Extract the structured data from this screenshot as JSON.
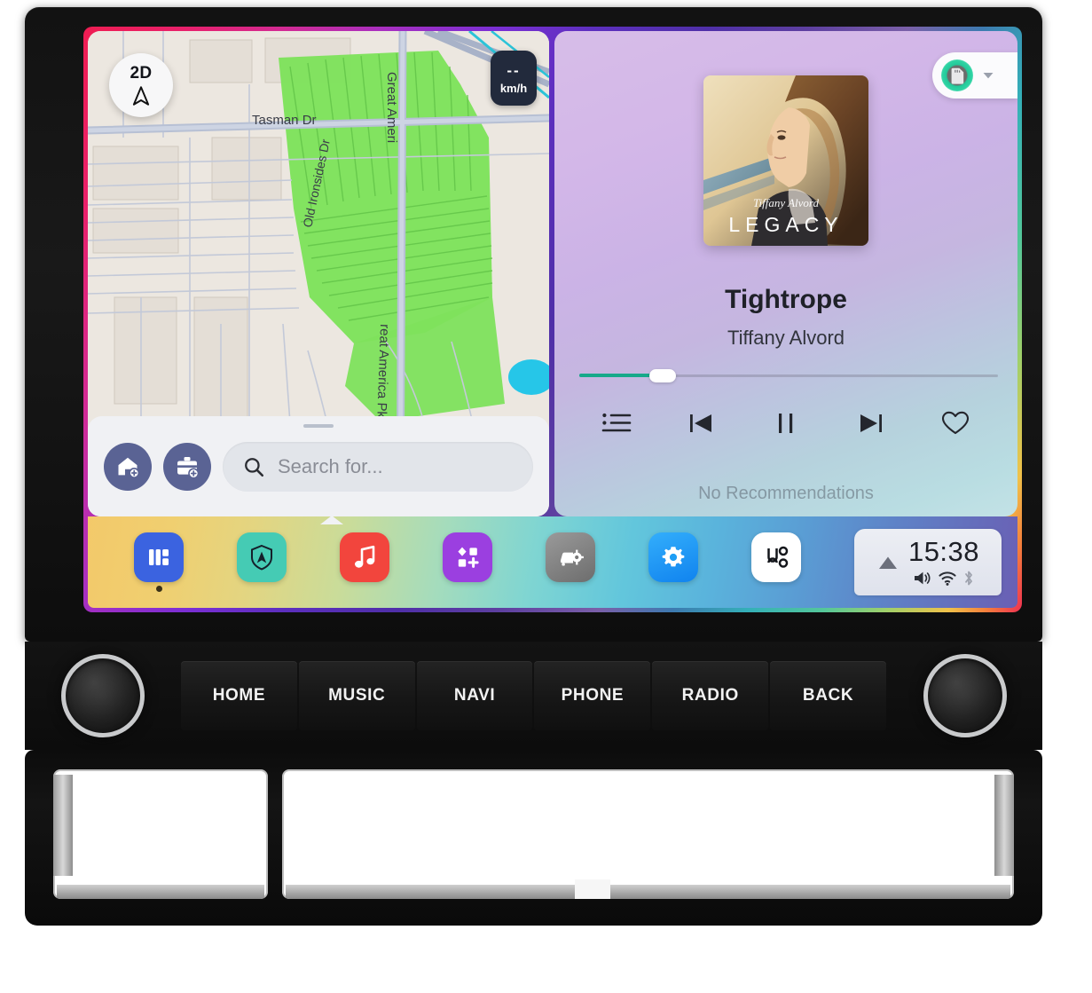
{
  "device": {
    "type": "car-head-unit",
    "screen_label": "touchscreen-display"
  },
  "map": {
    "view_mode_label": "2D",
    "compass_icon": "navigation-arrow-icon",
    "speed": {
      "value": "--",
      "unit": "km/h"
    },
    "streets": [
      "Tasman Dr",
      "Great America Pkwy",
      "Old Ironsides Dr",
      "Great America Pkwy"
    ],
    "shortcuts": [
      {
        "name": "home-shortcut",
        "icon": "home-add-icon"
      },
      {
        "name": "work-shortcut",
        "icon": "briefcase-add-icon"
      }
    ],
    "search": {
      "placeholder": "Search for...",
      "icon": "search-icon",
      "value": ""
    },
    "colors": {
      "land": "#ece7e0",
      "park_green": "#7ee25c",
      "water": "#26c6e8",
      "road": "#b7c0d4"
    }
  },
  "music": {
    "source_badge": {
      "icon": "sd-card-icon",
      "chevron": "chevron-down-icon",
      "ring_color": "#2fd4a4"
    },
    "album_art_label": "LEGACY",
    "album_art_signature": "Tiffany Alvord",
    "title": "Tightrope",
    "artist": "Tiffany Alvord",
    "progress_percent": 18,
    "progress_color": "#16a98a",
    "controls": [
      {
        "name": "playlist-button",
        "icon": "playlist-icon"
      },
      {
        "name": "previous-button",
        "icon": "skip-previous-icon"
      },
      {
        "name": "pause-button",
        "icon": "pause-icon"
      },
      {
        "name": "next-button",
        "icon": "skip-next-icon"
      },
      {
        "name": "favorite-button",
        "icon": "heart-outline-icon"
      }
    ],
    "recommendations_text": "No Recommendations"
  },
  "dock": {
    "items": [
      {
        "name": "dock-dashboard",
        "icon": "dashboard-icon",
        "color": "#3b63e0",
        "active": true
      },
      {
        "name": "dock-navigation",
        "icon": "navigation-shield-icon",
        "color": "#45cbb4",
        "active": false
      },
      {
        "name": "dock-music",
        "icon": "music-note-icon",
        "color": "#f2453d",
        "active": false
      },
      {
        "name": "dock-apps",
        "icon": "apps-grid-icon",
        "color": "#9b3fe0",
        "active": false
      },
      {
        "name": "dock-car-settings",
        "icon": "car-settings-icon",
        "color": "#7a7a7a",
        "active": false
      },
      {
        "name": "dock-settings",
        "icon": "gear-icon",
        "color": "#1e9ef5",
        "active": false
      },
      {
        "name": "dock-connection",
        "icon": "link-nodes-icon",
        "color": "#ffffff",
        "active": false
      }
    ],
    "status": {
      "time": "15:38",
      "triangle_icon": "triangle-up-icon",
      "volume_icon": "volume-icon",
      "wifi_icon": "wifi-icon",
      "bluetooth_icon": "bluetooth-icon"
    }
  },
  "hardware": {
    "left_knob": "volume-knob",
    "right_knob": "tune-knob",
    "buttons": [
      "HOME",
      "MUSIC",
      "NAVI",
      "PHONE",
      "RADIO",
      "BACK"
    ]
  }
}
